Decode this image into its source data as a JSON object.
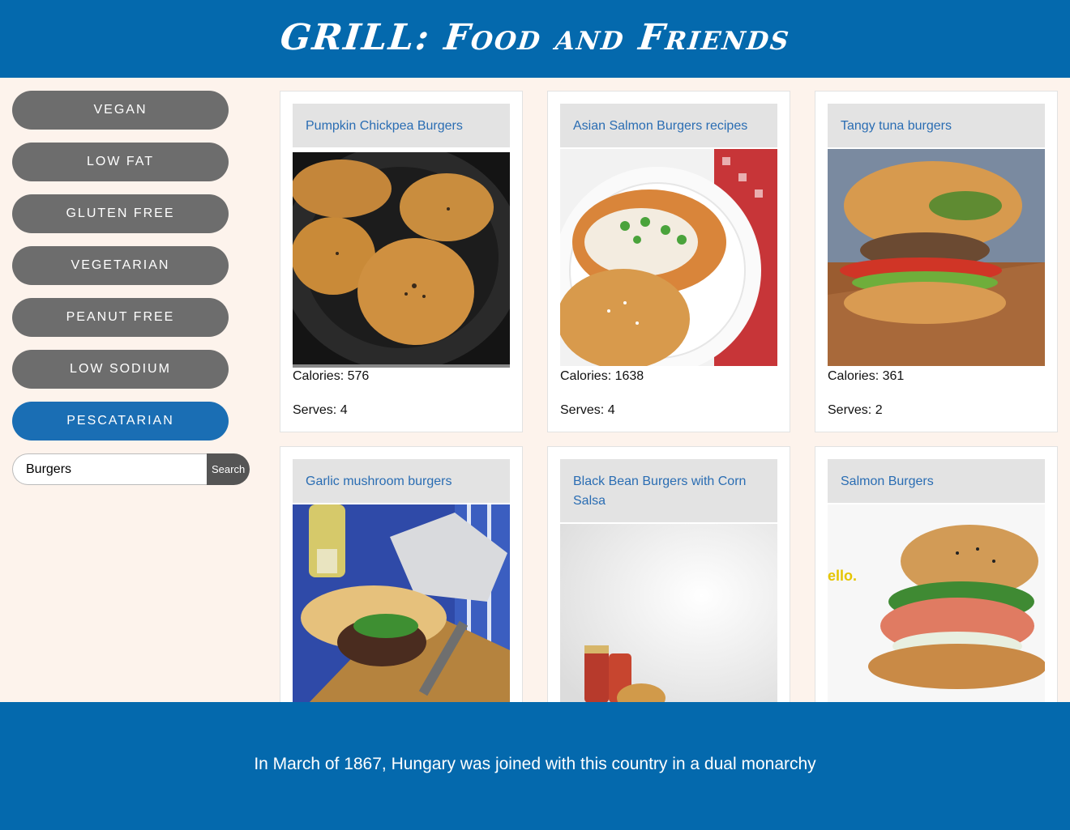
{
  "header": {
    "title": "GRILL: Food and Friends"
  },
  "sidebar": {
    "filters": [
      {
        "label": "VEGAN"
      },
      {
        "label": "LOW FAT"
      },
      {
        "label": "GLUTEN FREE"
      },
      {
        "label": "VEGETARIAN"
      },
      {
        "label": "PEANUT FREE"
      },
      {
        "label": "LOW SODIUM"
      },
      {
        "label": "PESCATARIAN"
      }
    ],
    "active_filter": "PESCATARIAN",
    "search": {
      "value": "Burgers",
      "button_label": "Search"
    }
  },
  "recipes": [
    {
      "title": "Pumpkin Chickpea Burgers",
      "calories": "Calories: 576",
      "serves": "Serves: 4"
    },
    {
      "title": "Asian Salmon Burgers recipes",
      "calories": "Calories: 1638",
      "serves": "Serves: 4"
    },
    {
      "title": "Tangy tuna burgers",
      "calories": "Calories: 361",
      "serves": "Serves: 2"
    },
    {
      "title": "Garlic mushroom burgers"
    },
    {
      "title": "Black Bean Burgers with Corn Salsa"
    },
    {
      "title": "Salmon Burgers",
      "image_text": "ello."
    }
  ],
  "footer": {
    "text": "In March of 1867, Hungary was joined with this country in a dual monarchy"
  },
  "colors": {
    "brand_blue": "#0469ad",
    "filter_gray": "#6d6d6d",
    "filter_active": "#1a6eb4",
    "link_blue": "#2a6db3"
  }
}
